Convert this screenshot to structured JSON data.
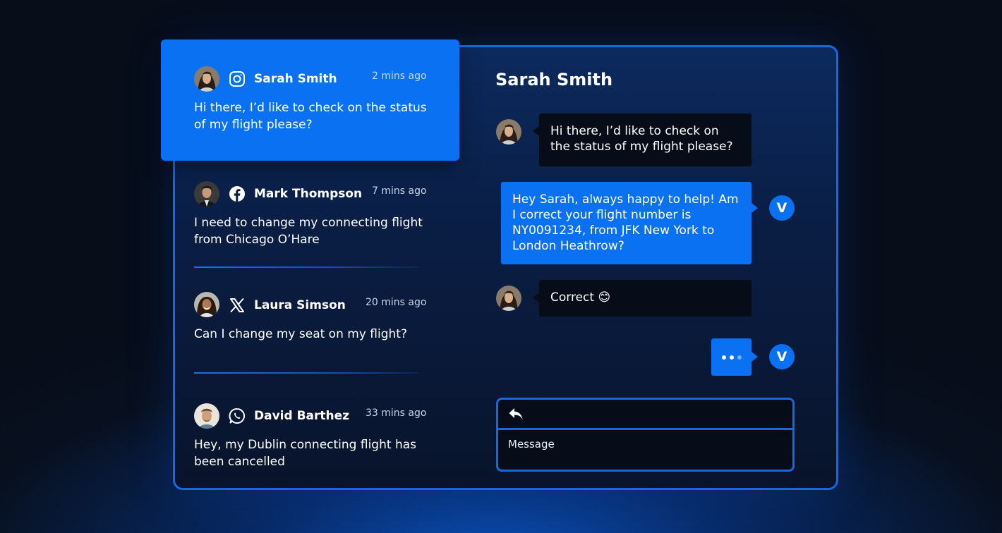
{
  "conversations": [
    {
      "name": "Sarah Smith",
      "channel": "instagram-icon",
      "time": "2 mins ago",
      "message": "Hi there, I’d like to check on the status of my flight please?",
      "active": true
    },
    {
      "name": "Mark Thompson",
      "channel": "facebook-icon",
      "time": "7 mins ago",
      "message": "I need to change my connecting flight from Chicago O’Hare"
    },
    {
      "name": "Laura Simson",
      "channel": "x-icon",
      "time": "20 mins ago",
      "message": "Can I change my seat on my flight?"
    },
    {
      "name": "David Barthez",
      "channel": "whatsapp-icon",
      "time": "33 mins ago",
      "message": "Hey, my Dublin connecting flight has been cancelled"
    }
  ],
  "chat": {
    "title": "Sarah Smith",
    "messages": [
      {
        "from": "customer",
        "text": "Hi there, I’d like to check on the status of my flight please?"
      },
      {
        "from": "agent",
        "text": "Hey Sarah, always happy to help! Am I correct your flight number is NY0091234, from JFK New York to London Heathrow?"
      },
      {
        "from": "customer",
        "text": "Correct 😊"
      }
    ],
    "agent_initial": "V"
  },
  "compose": {
    "placeholder": "Message",
    "reply_icon": "reply-icon"
  },
  "colors": {
    "accent": "#0a71f2",
    "border": "#1768e0",
    "dark_bubble": "#070d18"
  }
}
